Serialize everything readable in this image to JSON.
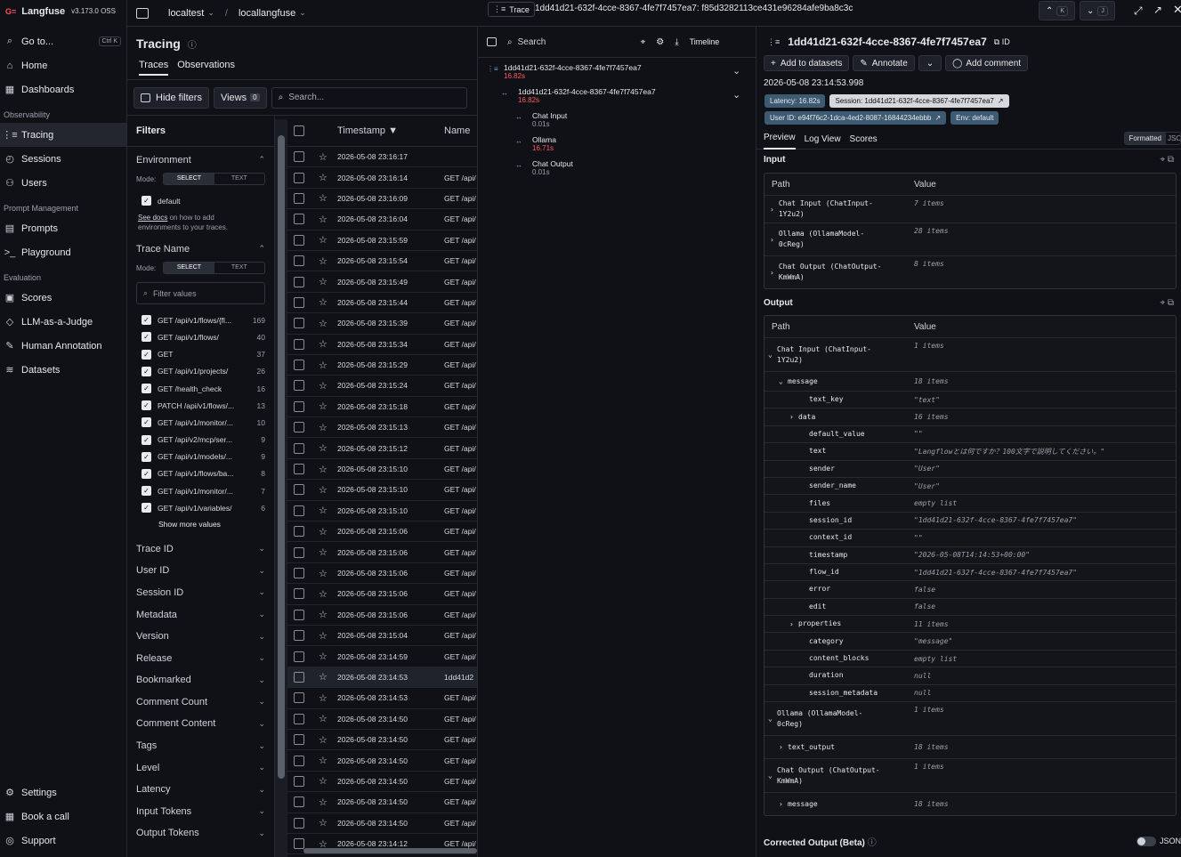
{
  "app": {
    "name": "Langfuse",
    "version": "v3.173.0 OSS"
  },
  "sidebar": {
    "goto": "Go to...",
    "goto_kbd": "Ctrl K",
    "items_top": [
      {
        "label": "Home",
        "icon": "home-icon"
      },
      {
        "label": "Dashboards",
        "icon": "dashboard-icon"
      }
    ],
    "sec_observability": "Observability",
    "items_obs": [
      {
        "label": "Tracing",
        "icon": "list-tree-icon"
      },
      {
        "label": "Sessions",
        "icon": "clock-icon"
      },
      {
        "label": "Users",
        "icon": "users-icon"
      }
    ],
    "sec_prompt": "Prompt Management",
    "items_prompt": [
      {
        "label": "Prompts",
        "icon": "file-text-icon"
      },
      {
        "label": "Playground",
        "icon": "terminal-icon"
      }
    ],
    "sec_eval": "Evaluation",
    "items_eval": [
      {
        "label": "Scores",
        "icon": "clipboard-icon"
      },
      {
        "label": "LLM-as-a-Judge",
        "icon": "lightbulb-icon"
      },
      {
        "label": "Human Annotation",
        "icon": "pen-icon"
      },
      {
        "label": "Datasets",
        "icon": "database-icon"
      }
    ],
    "items_bottom": [
      {
        "label": "Settings",
        "icon": "gear-icon"
      },
      {
        "label": "Book a call",
        "icon": "calendar-icon"
      },
      {
        "label": "Support",
        "icon": "life-buoy-icon"
      }
    ]
  },
  "topbar": {
    "org": "localtest",
    "project": "locallangfuse"
  },
  "tracing": {
    "title": "Tracing",
    "tabs": [
      "Traces",
      "Observations"
    ],
    "hide_filters": "Hide filters",
    "views": "Views",
    "views_count": "0",
    "search_placeholder": "Search..."
  },
  "filters": {
    "title": "Filters",
    "environment": {
      "label": "Environment",
      "mode_label": "Mode:",
      "mode_select": "SELECT",
      "mode_text": "TEXT",
      "value": "default",
      "docs_link": "See docs",
      "docs_text": " on how to add environments to your traces."
    },
    "trace_name": {
      "label": "Trace Name",
      "mode_label": "Mode:",
      "mode_select": "SELECT",
      "mode_text": "TEXT",
      "filter_placeholder": "Filter values",
      "values": [
        {
          "label": "GET /api/v1/flows/{fl...",
          "count": "169"
        },
        {
          "label": "GET /api/v1/flows/",
          "count": "40"
        },
        {
          "label": "GET",
          "count": "37"
        },
        {
          "label": "GET /api/v1/projects/",
          "count": "26"
        },
        {
          "label": "GET /health_check",
          "count": "16"
        },
        {
          "label": "PATCH /api/v1/flows/...",
          "count": "13"
        },
        {
          "label": "GET /api/v1/monitor/...",
          "count": "10"
        },
        {
          "label": "GET /api/v2/mcp/ser...",
          "count": "9"
        },
        {
          "label": "GET /api/v1/models/...",
          "count": "9"
        },
        {
          "label": "GET /api/v1/flows/ba...",
          "count": "8"
        },
        {
          "label": "GET /api/v1/monitor/...",
          "count": "7"
        },
        {
          "label": "GET /api/v1/variables/",
          "count": "6"
        }
      ],
      "show_more": "Show more values"
    },
    "collapsed": [
      "Trace ID",
      "User ID",
      "Session ID",
      "Metadata",
      "Version",
      "Release",
      "Bookmarked",
      "Comment Count",
      "Comment Content",
      "Tags",
      "Level",
      "Latency",
      "Input Tokens",
      "Output Tokens"
    ]
  },
  "table": {
    "col_timestamp": "Timestamp",
    "col_name": "Name",
    "rows": [
      {
        "ts": "2026-05-08 23:16:17",
        "name": ""
      },
      {
        "ts": "2026-05-08 23:16:14",
        "name": "GET /api/"
      },
      {
        "ts": "2026-05-08 23:16:09",
        "name": "GET /api/"
      },
      {
        "ts": "2026-05-08 23:16:04",
        "name": "GET /api/"
      },
      {
        "ts": "2026-05-08 23:15:59",
        "name": "GET /api/"
      },
      {
        "ts": "2026-05-08 23:15:54",
        "name": "GET /api/"
      },
      {
        "ts": "2026-05-08 23:15:49",
        "name": "GET /api/"
      },
      {
        "ts": "2026-05-08 23:15:44",
        "name": "GET /api/"
      },
      {
        "ts": "2026-05-08 23:15:39",
        "name": "GET /api/"
      },
      {
        "ts": "2026-05-08 23:15:34",
        "name": "GET /api/"
      },
      {
        "ts": "2026-05-08 23:15:29",
        "name": "GET /api/"
      },
      {
        "ts": "2026-05-08 23:15:24",
        "name": "GET /api/"
      },
      {
        "ts": "2026-05-08 23:15:18",
        "name": "GET /api/"
      },
      {
        "ts": "2026-05-08 23:15:13",
        "name": "GET /api/"
      },
      {
        "ts": "2026-05-08 23:15:12",
        "name": "GET /api/"
      },
      {
        "ts": "2026-05-08 23:15:10",
        "name": "GET /api/"
      },
      {
        "ts": "2026-05-08 23:15:10",
        "name": "GET /api/"
      },
      {
        "ts": "2026-05-08 23:15:10",
        "name": "GET /api/"
      },
      {
        "ts": "2026-05-08 23:15:06",
        "name": "GET /api/"
      },
      {
        "ts": "2026-05-08 23:15:06",
        "name": "GET /api/"
      },
      {
        "ts": "2026-05-08 23:15:06",
        "name": "GET /api/"
      },
      {
        "ts": "2026-05-08 23:15:06",
        "name": "GET /api/"
      },
      {
        "ts": "2026-05-08 23:15:06",
        "name": "GET /api/"
      },
      {
        "ts": "2026-05-08 23:15:04",
        "name": "GET /api/"
      },
      {
        "ts": "2026-05-08 23:14:59",
        "name": "GET /api/"
      },
      {
        "ts": "2026-05-08 23:14:53",
        "name": "1dd41d2"
      },
      {
        "ts": "2026-05-08 23:14:53",
        "name": "GET /api/"
      },
      {
        "ts": "2026-05-08 23:14:50",
        "name": "GET /api/"
      },
      {
        "ts": "2026-05-08 23:14:50",
        "name": "GET /api/"
      },
      {
        "ts": "2026-05-08 23:14:50",
        "name": "GET /api/"
      },
      {
        "ts": "2026-05-08 23:14:50",
        "name": "GET /api/"
      },
      {
        "ts": "2026-05-08 23:14:50",
        "name": "GET /api/"
      },
      {
        "ts": "2026-05-08 23:14:50",
        "name": "GET /api/"
      },
      {
        "ts": "2026-05-08 23:14:12",
        "name": "GET /api/"
      }
    ],
    "selected_index": 25
  },
  "trace_header": {
    "label": "Trace",
    "id": "1dd41d21-632f-4cce-8367-4fe7f7457ea7: f85d3282113ce431e96284afe9ba8c3c",
    "kbd_up": "K",
    "kbd_down": "J"
  },
  "tree": {
    "search": "Search",
    "timeline": "Timeline",
    "nodes": [
      {
        "name": "1dd41d21-632f-4cce-8367-4fe7f7457ea7",
        "time": "16.82s",
        "time_color": "#ff5a5a"
      },
      {
        "name": "1dd41d21-632f-4cce-8367-4fe7f7457ea7",
        "time": "16.82s",
        "time_color": "#ff5a5a"
      },
      {
        "name": "Chat Input",
        "time": "0.01s",
        "time_color": "#9aa0ab"
      },
      {
        "name": "Ollama",
        "time": "16.71s",
        "time_color": "#ff5a5a"
      },
      {
        "name": "Chat Output",
        "time": "0.01s",
        "time_color": "#9aa0ab"
      }
    ]
  },
  "detail": {
    "title": "1dd41d21-632f-4cce-8367-4fe7f7457ea7",
    "id_btn": "ID",
    "add_datasets": "Add to datasets",
    "annotate": "Annotate",
    "add_comment": "Add comment",
    "timestamp": "2026-05-08 23:14:53.998",
    "badges": {
      "latency": "Latency: 16.82s",
      "session": "Session: 1dd41d21-632f-4cce-8367-4fe7f7457ea7",
      "user": "User ID: e94f76c2-1dca-4ed2-8087-16844234ebbb",
      "env": "Env: default"
    },
    "tabs": [
      "Preview",
      "Log View",
      "Scores"
    ],
    "formatted": "Formatted",
    "json": "JSON",
    "input_label": "Input",
    "output_label": "Output",
    "col_path": "Path",
    "col_value": "Value",
    "input_rows": [
      {
        "path": "Chat Input (ChatInput-\n1Y2u2)",
        "value": "7 items"
      },
      {
        "path": "Ollama (OllamaModel-\n0cReg)",
        "value": "28 items"
      },
      {
        "path": "Chat Output (ChatOutput-\nKmWmA)",
        "value": "8 items"
      }
    ],
    "output_rows": [
      {
        "indent": 0,
        "arrow": "⌄",
        "path": "Chat Input (ChatInput-\n1Y2u2)",
        "value": "1 items",
        "kind": "meta",
        "h": 38
      },
      {
        "indent": 1,
        "arrow": "⌄",
        "path": "message",
        "value": "18 items",
        "kind": "meta",
        "h": 22
      },
      {
        "indent": 3,
        "arrow": "",
        "path": "text_key",
        "value": "\"text\"",
        "kind": "str",
        "h": 19.4
      },
      {
        "indent": 2,
        "arrow": "›",
        "path": "data",
        "value": "16 items",
        "kind": "meta",
        "h": 19.4
      },
      {
        "indent": 3,
        "arrow": "",
        "path": "default_value",
        "value": "\"\"",
        "kind": "str",
        "h": 19.4
      },
      {
        "indent": 3,
        "arrow": "",
        "path": "text",
        "value": "\"Langflowとは何ですか？100文字で説明してください。\"",
        "kind": "str",
        "h": 19.4
      },
      {
        "indent": 3,
        "arrow": "",
        "path": "sender",
        "value": "\"User\"",
        "kind": "str",
        "h": 19.4
      },
      {
        "indent": 3,
        "arrow": "",
        "path": "sender_name",
        "value": "\"User\"",
        "kind": "str",
        "h": 19.4
      },
      {
        "indent": 3,
        "arrow": "",
        "path": "files",
        "value": "empty list",
        "kind": "meta",
        "h": 19.4
      },
      {
        "indent": 3,
        "arrow": "",
        "path": "session_id",
        "value": "\"1dd41d21-632f-4cce-8367-4fe7f7457ea7\"",
        "kind": "str",
        "h": 19.4
      },
      {
        "indent": 3,
        "arrow": "",
        "path": "context_id",
        "value": "\"\"",
        "kind": "str",
        "h": 19.4
      },
      {
        "indent": 3,
        "arrow": "",
        "path": "timestamp",
        "value": "\"2026-05-08T14:14:53+00:00\"",
        "kind": "str",
        "h": 19.4
      },
      {
        "indent": 3,
        "arrow": "",
        "path": "flow_id",
        "value": "\"1dd41d21-632f-4cce-8367-4fe7f7457ea7\"",
        "kind": "str",
        "h": 19.4
      },
      {
        "indent": 3,
        "arrow": "",
        "path": "error",
        "value": "false",
        "kind": "bool",
        "h": 19.4
      },
      {
        "indent": 3,
        "arrow": "",
        "path": "edit",
        "value": "false",
        "kind": "bool",
        "h": 19.4
      },
      {
        "indent": 2,
        "arrow": "›",
        "path": "properties",
        "value": "11 items",
        "kind": "meta",
        "h": 19.4
      },
      {
        "indent": 3,
        "arrow": "",
        "path": "category",
        "value": "\"message\"",
        "kind": "str",
        "h": 19.4
      },
      {
        "indent": 3,
        "arrow": "",
        "path": "content_blocks",
        "value": "empty list",
        "kind": "meta",
        "h": 19.4
      },
      {
        "indent": 3,
        "arrow": "",
        "path": "duration",
        "value": "null",
        "kind": "meta",
        "h": 19.4
      },
      {
        "indent": 3,
        "arrow": "",
        "path": "session_metadata",
        "value": "null",
        "kind": "meta",
        "h": 19.4
      },
      {
        "indent": 0,
        "arrow": "⌄",
        "path": "Ollama (OllamaModel-\n0cReg)",
        "value": "1 items",
        "kind": "meta",
        "h": 38
      },
      {
        "indent": 1,
        "arrow": "›",
        "path": "text_output",
        "value": "18 items",
        "kind": "meta",
        "h": 26
      },
      {
        "indent": 0,
        "arrow": "⌄",
        "path": "Chat Output (ChatOutput-\nKmWmA)",
        "value": "1 items",
        "kind": "meta",
        "h": 38
      },
      {
        "indent": 1,
        "arrow": "›",
        "path": "message",
        "value": "18 items",
        "kind": "meta",
        "h": 26
      }
    ],
    "corrected_output": "Corrected Output (Beta)",
    "corrected_json": "JSON"
  }
}
